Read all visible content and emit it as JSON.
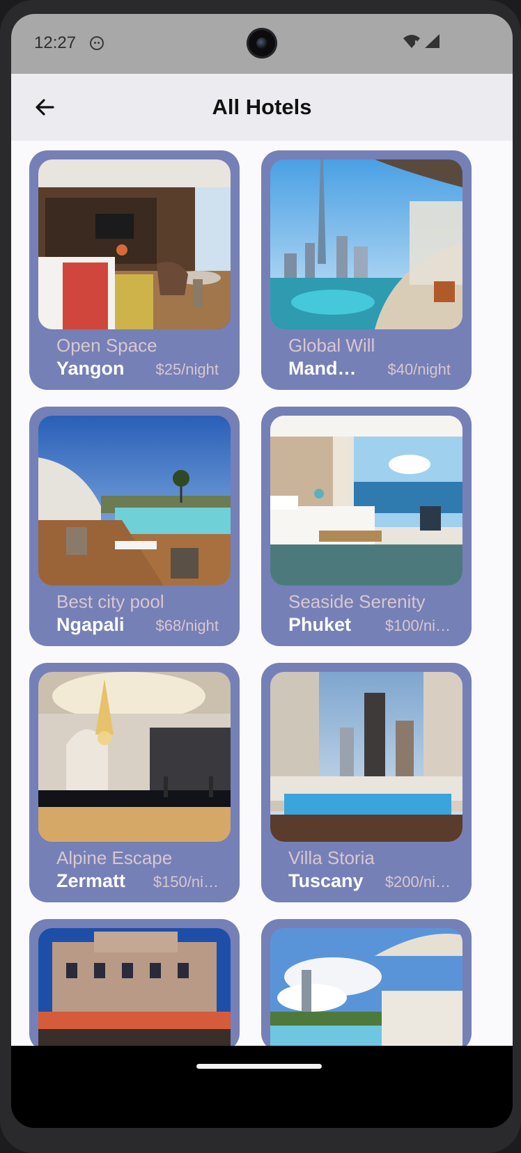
{
  "status": {
    "time": "12:27"
  },
  "header": {
    "title": "All Hotels"
  },
  "colors": {
    "card_bg": "#7580b6",
    "name_text": "#d9c6cf",
    "city_text": "#ffffff",
    "app_bar_bg": "#ecebf0"
  },
  "icons": {
    "back": "arrow-left-icon",
    "status": "face-icon",
    "wifi": "wifi-icon",
    "signal": "signal-icon"
  },
  "hotels": [
    {
      "name": "Open Space",
      "city": "Yangon",
      "price": "$25/night",
      "image": "hotel-room-interior"
    },
    {
      "name": "Global Will",
      "city": "Mand…",
      "price": "$40/night",
      "image": "city-skyline-balcony"
    },
    {
      "name": "Best city pool",
      "city": "Ngapali",
      "price": "$68/night",
      "image": "pool-terrace-dining"
    },
    {
      "name": "Seaside Serenity",
      "city": "Phuket",
      "price": "$100/ni…",
      "image": "seaview-bedroom"
    },
    {
      "name": "Alpine Escape",
      "city": "Zermatt",
      "price": "$150/ni…",
      "image": "grand-lobby-chandelier"
    },
    {
      "name": "Villa Storia",
      "city": "Tuscany",
      "price": "$200/ni…",
      "image": "rooftop-pool-towers"
    },
    {
      "name": "",
      "city": "",
      "price": "",
      "image": "palace-hotel-facade"
    },
    {
      "name": "",
      "city": "",
      "price": "",
      "image": "pool-umbrellas-skyline"
    }
  ]
}
